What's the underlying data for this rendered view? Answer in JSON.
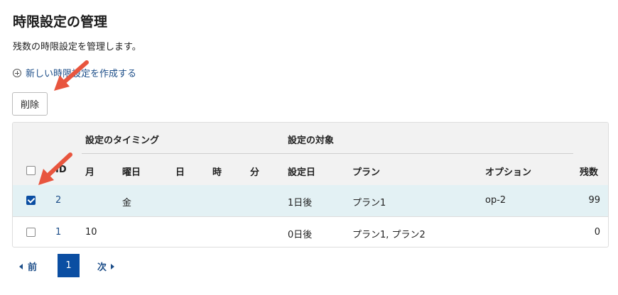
{
  "page": {
    "title": "時限設定の管理",
    "description": "残数の時限設定を管理します。",
    "new_link": "新しい時限設定を作成する",
    "delete_button": "削除"
  },
  "table": {
    "group_timing": "設定のタイミング",
    "group_target": "設定の対象",
    "headers": {
      "id": "ID",
      "month": "月",
      "weekday": "曜日",
      "day": "日",
      "hour": "時",
      "minute": "分",
      "setting_day": "設定日",
      "plan": "プラン",
      "option": "オプション",
      "remaining": "残数"
    },
    "rows": [
      {
        "checked": true,
        "id": "2",
        "month": "",
        "weekday": "金",
        "day": "",
        "hour": "",
        "minute": "",
        "setting_day": "1日後",
        "plan": "プラン1",
        "option": "op-2",
        "remaining": "99"
      },
      {
        "checked": false,
        "id": "1",
        "month": "10",
        "weekday": "",
        "day": "",
        "hour": "",
        "minute": "",
        "setting_day": "0日後",
        "plan": "プラン1, プラン2",
        "option": "",
        "remaining": "0"
      }
    ]
  },
  "pagination": {
    "prev": "前",
    "current": "1",
    "next": "次"
  },
  "colors": {
    "link": "#1d4e89",
    "selected_row": "#e3f1f4",
    "header_bg": "#f2f2f2",
    "pager_active": "#0b4ea2",
    "annotation_arrow": "#e8553e"
  }
}
